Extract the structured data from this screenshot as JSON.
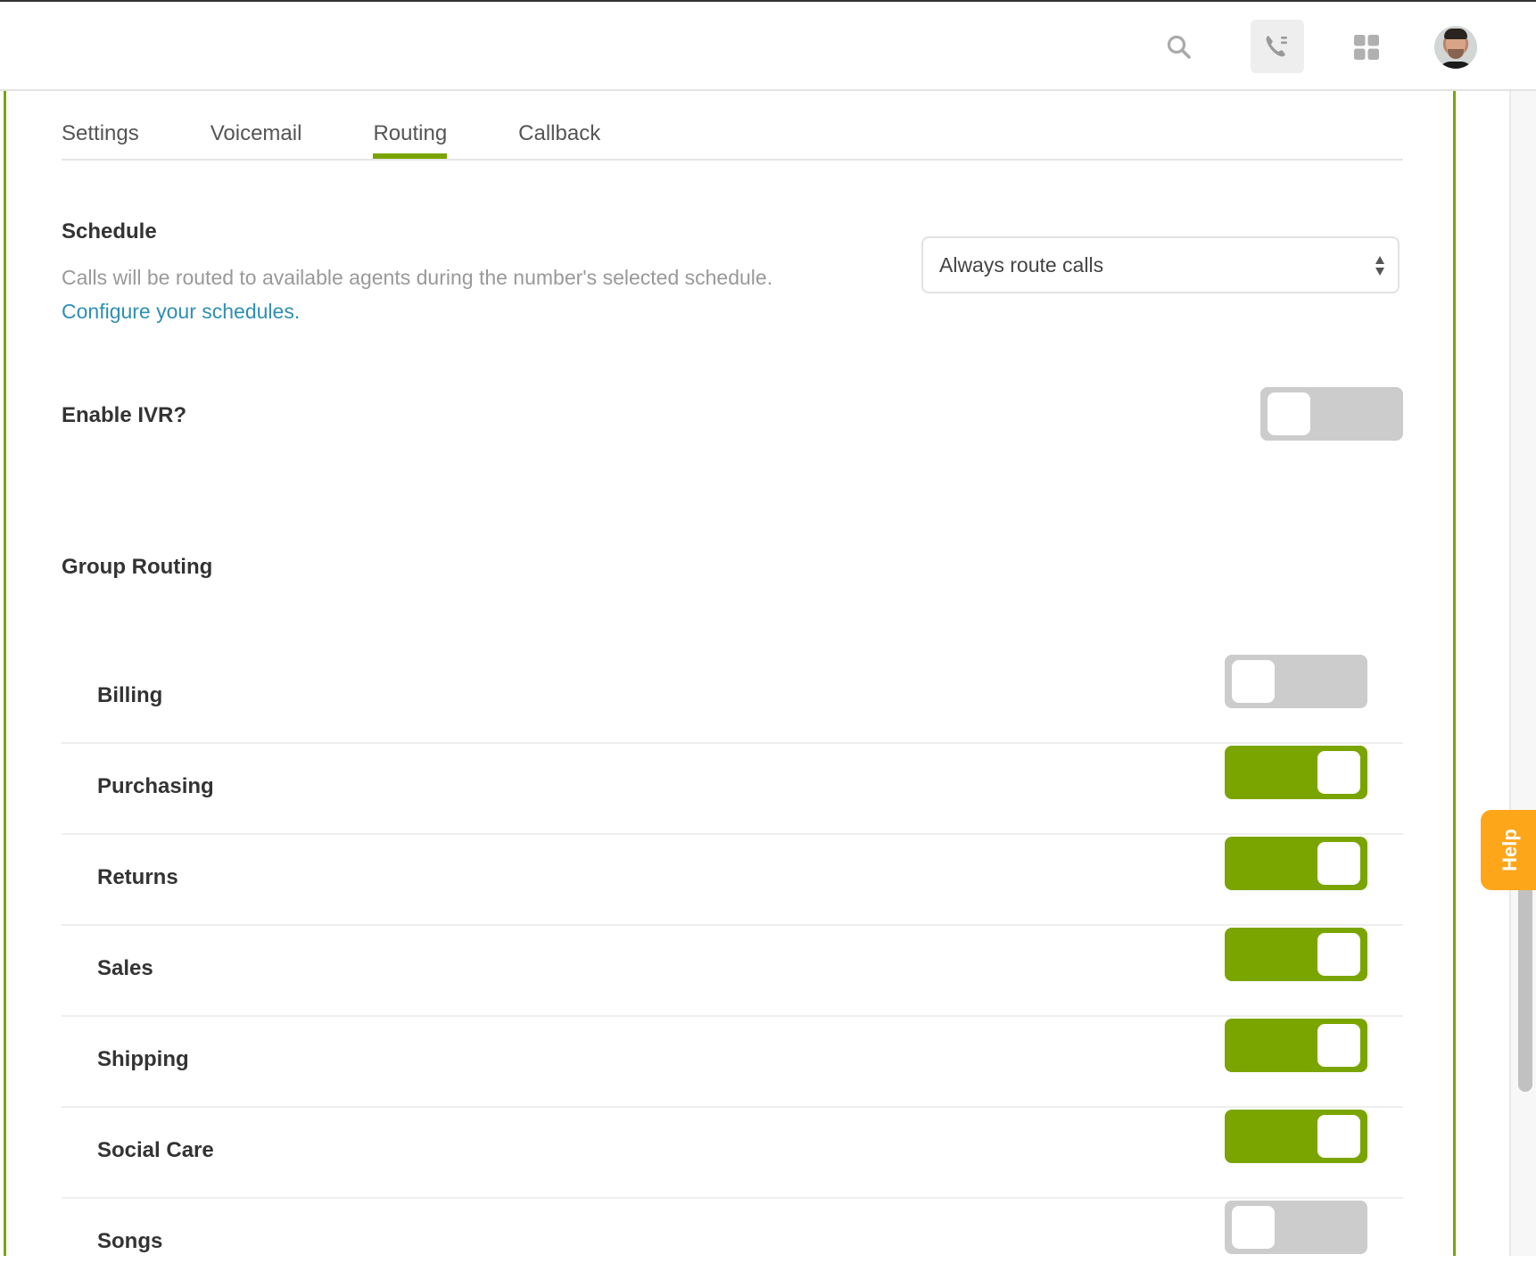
{
  "header": {
    "icons": {
      "search": "search-icon",
      "phone": "phone-list-icon",
      "apps": "apps-grid-icon",
      "avatar": "user-avatar"
    }
  },
  "tabs": [
    {
      "label": "Settings",
      "active": false
    },
    {
      "label": "Voicemail",
      "active": false
    },
    {
      "label": "Routing",
      "active": true
    },
    {
      "label": "Callback",
      "active": false
    }
  ],
  "schedule": {
    "title": "Schedule",
    "description": "Calls will be routed to available agents during the number's selected schedule.",
    "link": "Configure your schedules.",
    "select_value": "Always route calls"
  },
  "ivr": {
    "title": "Enable IVR?",
    "enabled": false
  },
  "group_routing": {
    "title": "Group Routing",
    "groups": [
      {
        "name": "Billing",
        "enabled": false
      },
      {
        "name": "Purchasing",
        "enabled": true
      },
      {
        "name": "Returns",
        "enabled": true
      },
      {
        "name": "Sales",
        "enabled": true
      },
      {
        "name": "Shipping",
        "enabled": true
      },
      {
        "name": "Social Care",
        "enabled": true
      },
      {
        "name": "Songs",
        "enabled": false
      }
    ]
  },
  "help": {
    "label": "Help"
  },
  "colors": {
    "accent": "#7aa500",
    "link": "#2e8fb3",
    "help": "#fea61a",
    "toggle_off": "#cccccc"
  }
}
